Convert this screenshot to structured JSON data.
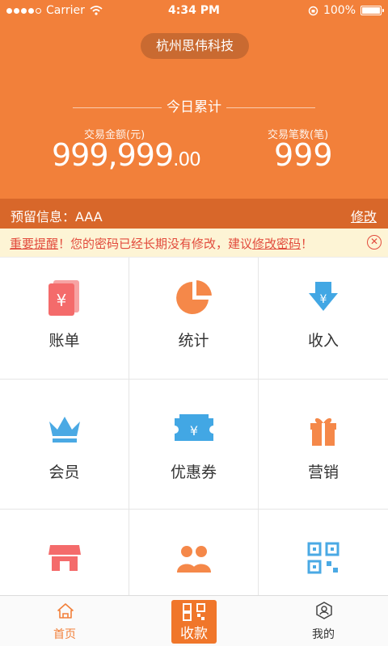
{
  "status": {
    "carrier": "Carrier",
    "time": "4:34 PM",
    "battery": "100%"
  },
  "header": {
    "company": "杭州思伟科技",
    "today_label": "今日累计",
    "amount_label": "交易金额(元)",
    "amount_int": "999,999",
    "amount_dec": ".00",
    "count_label": "交易笔数(笔)",
    "count": "999"
  },
  "reserve": {
    "label": "预留信息：AAA",
    "edit": "修改"
  },
  "reminder": {
    "prefix": "重要提醒",
    "middle": "！您的密码已经长期没有修改，建议",
    "link": "修改密码",
    "suffix": "！",
    "close_icon": "close-circle-icon"
  },
  "grid": {
    "items": [
      {
        "label": "账单",
        "icon": "bill-icon",
        "color": "#f46b6b"
      },
      {
        "label": "统计",
        "icon": "pie-chart-icon",
        "color": "#f58849"
      },
      {
        "label": "收入",
        "icon": "income-arrow-icon",
        "color": "#42a7e4"
      },
      {
        "label": "会员",
        "icon": "crown-icon",
        "color": "#4aa9e4"
      },
      {
        "label": "优惠券",
        "icon": "coupon-icon",
        "color": "#42a7e4"
      },
      {
        "label": "营销",
        "icon": "gift-icon",
        "color": "#f58849"
      },
      {
        "label": "",
        "icon": "shop-icon",
        "color": "#f46b6b"
      },
      {
        "label": "",
        "icon": "people-icon",
        "color": "#f58849"
      },
      {
        "label": "",
        "icon": "qrcode-icon",
        "color": "#4aa9e4"
      }
    ]
  },
  "tabs": {
    "home": "首页",
    "pay": "收款",
    "mine": "我的",
    "accent": "#f2803a"
  }
}
